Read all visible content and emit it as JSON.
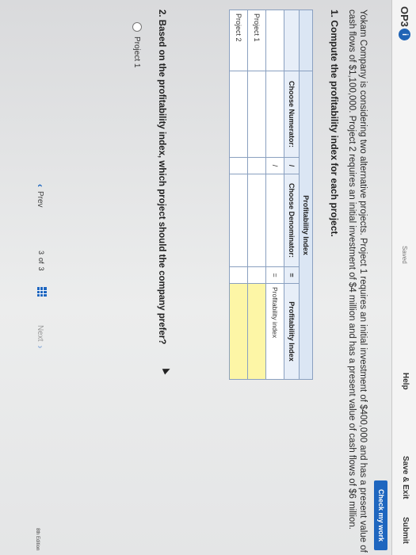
{
  "header": {
    "question_number": "OP3",
    "info_icon": "i",
    "status": "Saved",
    "help_label": "Help",
    "save_exit_label": "Save & Exit",
    "submit_label": "Submit",
    "check_work_label": "Check my work"
  },
  "problem": {
    "text": "Yokam Company is considering two alternative projects. Project 1 requires an initial investment of $400,000 and has a present value of cash flows of $1,100,000. Project 2 requires an initial investment of $4 million and has a present value of cash flows of $6 million.",
    "question1": "1. Compute the profitability index for each project.",
    "question2": "2. Based on the profitability index, which project should the company prefer?"
  },
  "table": {
    "title": "Profitability Index",
    "headers": {
      "numerator": "Choose Numerator:",
      "divide": "/",
      "denominator": "Choose Denominator:",
      "equals": "=",
      "result": "Profitability Index"
    },
    "sub_row": {
      "divide": "/",
      "equals": "=",
      "result_label": "Profitability index"
    },
    "rows": [
      {
        "label": "Project 1",
        "divide": "",
        "equals": ""
      },
      {
        "label": "Project 2",
        "divide": "",
        "equals": ""
      }
    ]
  },
  "answer_options": [
    {
      "label": "Project 1",
      "selected": false
    }
  ],
  "navigation": {
    "prev_label": "Prev",
    "page_current": "3",
    "page_of": "of",
    "page_total": "3",
    "next_label": "Next",
    "edition_label": "8th Edition"
  },
  "colors": {
    "accent": "#1e66bf",
    "table_header": "#dbe6f4",
    "input_highlight": "#fdf6a6"
  }
}
